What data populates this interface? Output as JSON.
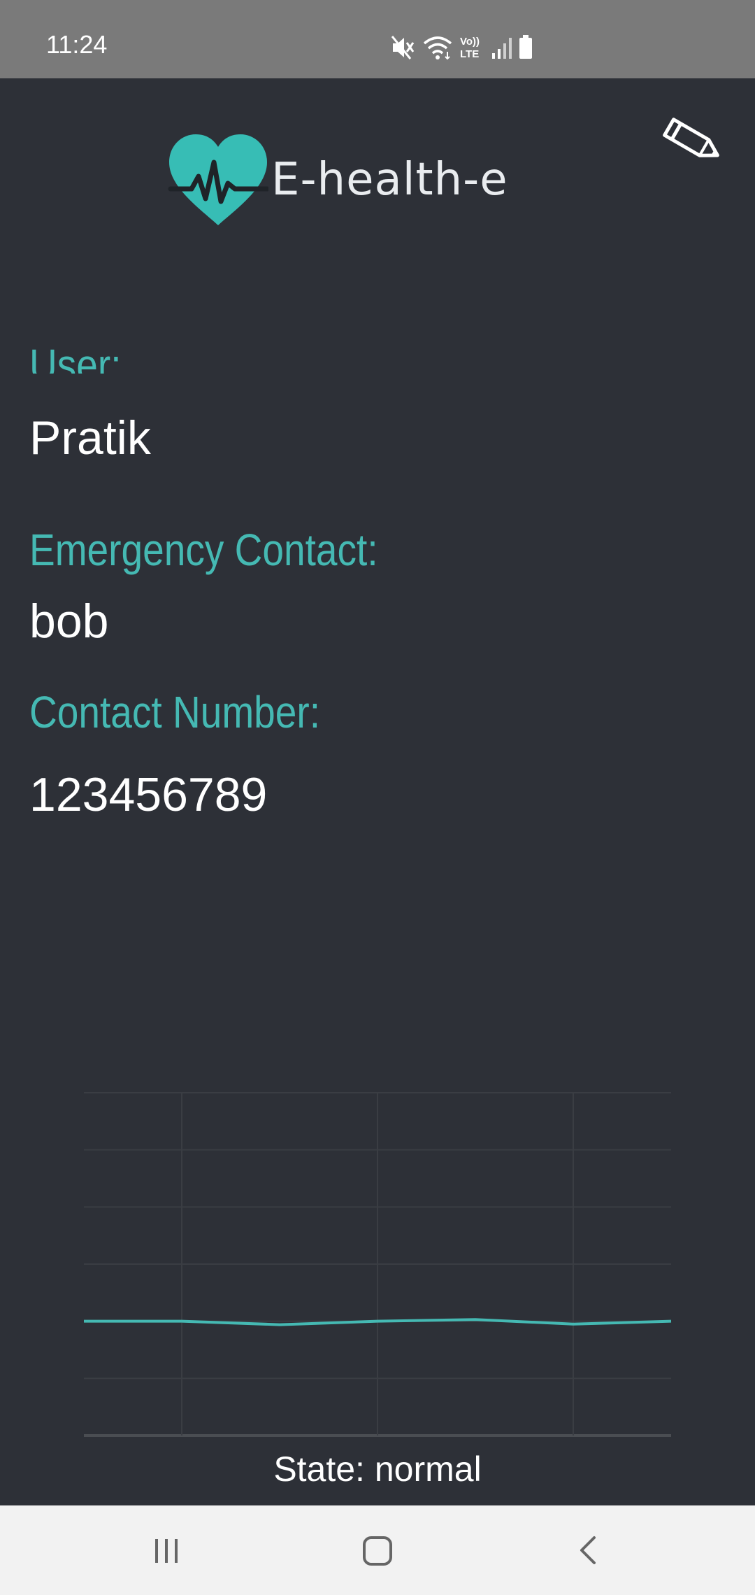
{
  "status_bar": {
    "time": "11:24",
    "icons": [
      "mute-icon",
      "wifi-icon",
      "volte-icon",
      "signal-icon",
      "battery-icon"
    ],
    "volte_text_top": "Vo))",
    "volte_text_bottom": "LTE"
  },
  "header": {
    "app_title": "E-health-e",
    "logo_icon": "heart-pulse-icon",
    "edit_icon": "pencil-icon"
  },
  "profile": {
    "user_label": "User:",
    "user_value": "Pratik",
    "emergency_label": "Emergency Contact:",
    "emergency_value": "bob",
    "number_label": "Contact Number:",
    "number_value": "123456789"
  },
  "chart_data": {
    "type": "line",
    "title": "",
    "xlabel": "",
    "ylabel": "",
    "grid": true,
    "color": "#45b9b3",
    "ylim": [
      0,
      6
    ],
    "x": [
      0,
      1,
      2,
      3,
      4,
      5,
      6
    ],
    "series": [
      {
        "values": [
          2.0,
          2.0,
          1.94,
          2.0,
          2.03,
          1.95,
          2.0
        ]
      }
    ]
  },
  "state": {
    "text": "State: normal"
  },
  "nav_bar": {
    "recents_icon": "recents-icon",
    "home_icon": "home-icon",
    "back_icon": "back-icon"
  },
  "colors": {
    "accent": "#45b9b3",
    "background": "#2d3037",
    "status_bar": "#7a7a7a",
    "nav_bar": "#f2f2f2"
  }
}
